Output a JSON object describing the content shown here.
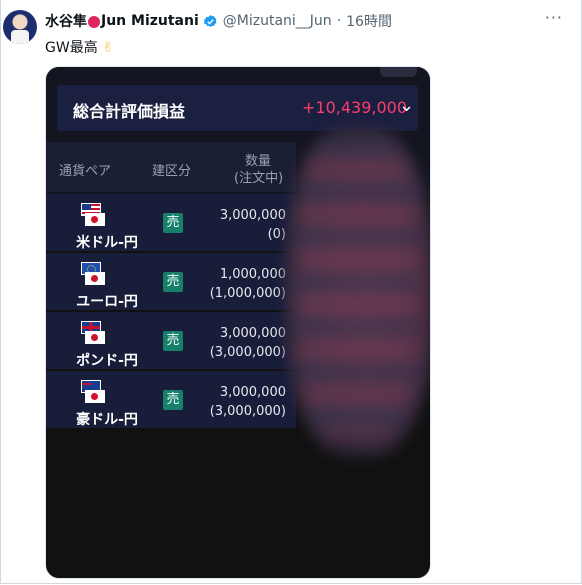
{
  "tweet": {
    "display_name": "水谷隼",
    "display_name_suffix": "Jun Mizutani",
    "handle": "@Mizutani__Jun",
    "separator": "·",
    "time": "16時間",
    "more": "···",
    "text": "GW最高",
    "emoji": "✌"
  },
  "screenshot": {
    "summary_label": "総合計評価損益",
    "summary_value": "+10,439,000",
    "summary_chevron": "⌄",
    "columns": {
      "pair": "通貨ペア",
      "side": "建区分",
      "qty_line1": "数量",
      "qty_line2": "(注文中)"
    },
    "rows": [
      {
        "pair": "米ドル-円",
        "side": "売",
        "qty": "3,000,000",
        "pending": "(0)",
        "flag": "us"
      },
      {
        "pair": "ユーロ-円",
        "side": "売",
        "qty": "1,000,000",
        "pending": "(1,000,000)",
        "flag": "eu"
      },
      {
        "pair": "ポンド-円",
        "side": "売",
        "qty": "3,000,000",
        "pending": "(3,000,000)",
        "flag": "gb"
      },
      {
        "pair": "豪ドル-円",
        "side": "売",
        "qty": "3,000,000",
        "pending": "(3,000,000)",
        "flag": "au"
      }
    ]
  },
  "colors": {
    "accent_value": "#ff3b6b",
    "sell_badge": "#17806a",
    "verified": "#1d9bf0"
  }
}
